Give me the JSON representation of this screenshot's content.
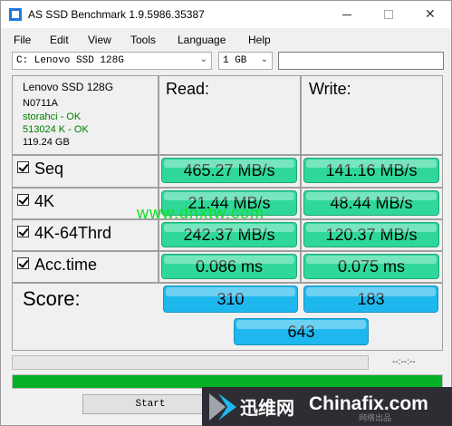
{
  "window": {
    "title": "AS SSD Benchmark 1.9.5986.35387",
    "close_glyph": "✕"
  },
  "menu": [
    "File",
    "Edit",
    "View",
    "Tools",
    "Language",
    "Help"
  ],
  "toolbar": {
    "drive": "C: Lenovo SSD 128G",
    "size": "1 GB",
    "dropdown_glyph": "⌄",
    "text_input": ""
  },
  "info": {
    "model": "Lenovo SSD 128G",
    "firmware": "N0711A",
    "driver": "storahci - OK",
    "alignment": "513024 K - OK",
    "capacity": "119.24 GB"
  },
  "headers": {
    "read": "Read:",
    "write": "Write:"
  },
  "tests": [
    {
      "label": "Seq",
      "checked": true,
      "read": "465.27 MB/s",
      "write": "141.16 MB/s"
    },
    {
      "label": "4K",
      "checked": true,
      "read": "21.44 MB/s",
      "write": "48.44 MB/s"
    },
    {
      "label": "4K-64Thrd",
      "checked": true,
      "read": "242.37 MB/s",
      "write": "120.37 MB/s"
    },
    {
      "label": "Acc.time",
      "checked": true,
      "read": "0.086 ms",
      "write": "0.075 ms"
    }
  ],
  "score": {
    "label": "Score:",
    "read": "310",
    "write": "183",
    "total": "643"
  },
  "progress": {
    "time_readout": "--:--:--",
    "fraction": 1.0
  },
  "start_label": "Start",
  "colors": {
    "result_green": "#2fd89a",
    "score_blue": "#1fb8ee",
    "progress_green": "#06b025",
    "ok_text": "#008000"
  },
  "watermark": "www.dnxtw.com",
  "logo": {
    "cn": "迅维网",
    "en": "Chinafix.com",
    "sub": "网络出品"
  }
}
